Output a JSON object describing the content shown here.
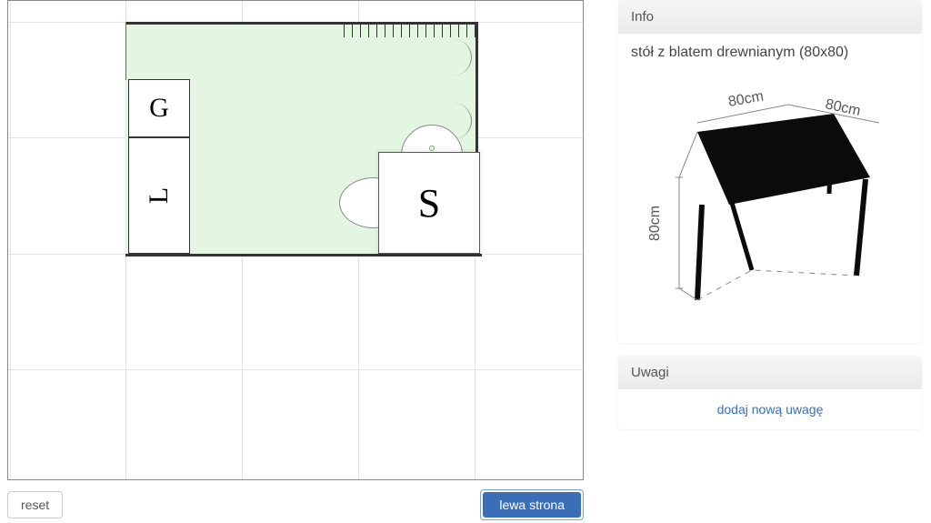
{
  "canvas": {
    "blocks": {
      "g": "G",
      "l": "L",
      "s": "S"
    }
  },
  "buttons": {
    "reset": "reset",
    "left_side": "lewa strona"
  },
  "info": {
    "header": "Info",
    "item_title": "stół z blatem drewnianym (80x80)",
    "dims": {
      "w": "80cm",
      "d": "80cm",
      "h": "80cm"
    }
  },
  "notes": {
    "header": "Uwagi",
    "add_link": "dodaj nową uwagę"
  }
}
